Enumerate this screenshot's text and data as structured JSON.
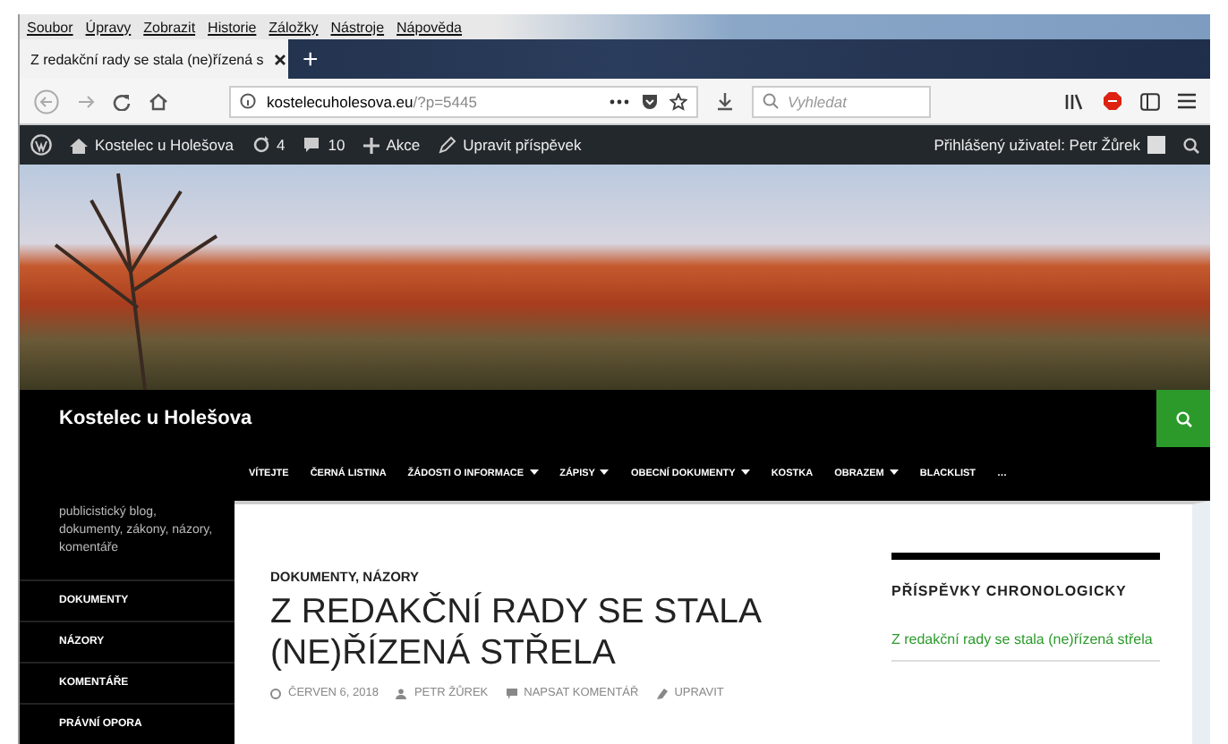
{
  "menu_bar": [
    "Soubor",
    "Úpravy",
    "Zobrazit",
    "Historie",
    "Záložky",
    "Nástroje",
    "Nápověda"
  ],
  "tabs": [
    {
      "title": "Z redakční rady se stala (ne)řízená s",
      "selected": true
    }
  ],
  "new_tab": "+",
  "address": {
    "host": "kostelecuholesova.eu",
    "path": "/?p=5445"
  },
  "search": {
    "placeholder": "Vyhledat"
  },
  "admin_bar": {
    "site": "Kostelec u Holešova",
    "updates": "4",
    "comments": "10",
    "new": "Akce",
    "edit": "Upravit příspěvek",
    "user": "Přihlášený uživatel: Petr Žůrek"
  },
  "site_title": "Kostelec u Holešova",
  "nav": [
    {
      "label": "VÍTEJTE",
      "dropdown": false
    },
    {
      "label": "ČERNÁ LISTINA",
      "dropdown": false
    },
    {
      "label": "ŽÁDOSTI O INFORMACE",
      "dropdown": true
    },
    {
      "label": "ZÁPISY",
      "dropdown": true
    },
    {
      "label": "OBECNÍ DOKUMENTY",
      "dropdown": true
    },
    {
      "label": "KOSTKA",
      "dropdown": false
    },
    {
      "label": "OBRAZEM",
      "dropdown": true
    },
    {
      "label": "BLACKLIST",
      "dropdown": false
    },
    {
      "label": "…",
      "dropdown": false
    }
  ],
  "sidebar": {
    "description": "publicistický blog, dokumenty, zákony, názory, komentáře",
    "items": [
      "DOKUMENTY",
      "NÁZORY",
      "KOMENTÁŘE",
      "PRÁVNÍ OPORA"
    ]
  },
  "post": {
    "categories": "DOKUMENTY, NÁZORY",
    "title": "Z REDAKČNÍ RADY SE STALA (NE)ŘÍZENÁ STŘELA",
    "date": "ČERVEN 6, 2018",
    "author": "PETR ŽŮREK",
    "comment": "NAPSAT KOMENTÁŘ",
    "edit": "UPRAVIT"
  },
  "widget": {
    "title": "PŘÍSPĚVKY CHRONOLOGICKY",
    "links": [
      "Z redakční rady se stala (ne)řízená střela"
    ]
  }
}
